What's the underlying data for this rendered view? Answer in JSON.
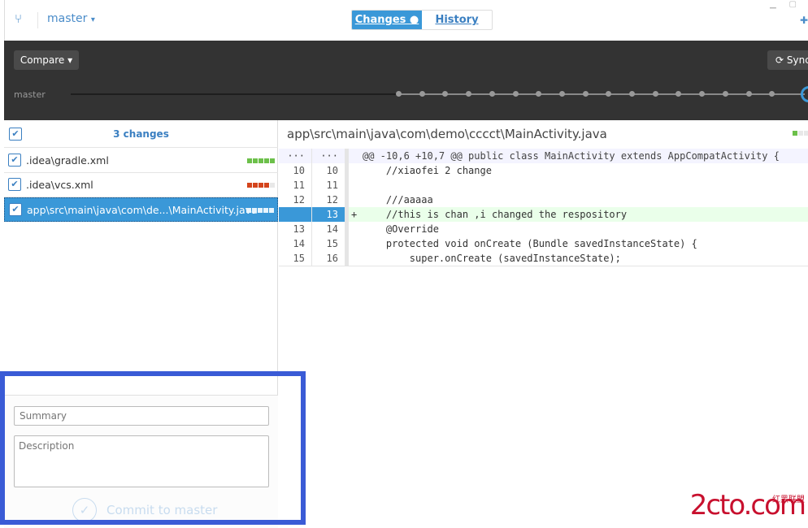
{
  "topbar": {
    "branch": "master",
    "branch_caret": "▾",
    "tabs": [
      {
        "label": "Changes ●",
        "active": true
      },
      {
        "label": "History",
        "active": false
      }
    ]
  },
  "toolbar": {
    "compare_label": "Compare ▾",
    "sync_label": "⟳ Sync",
    "timeline_branch": "master"
  },
  "changes": {
    "header": "3 changes",
    "files": [
      {
        "name": ".idea\\gradle.xml",
        "bars": [
          "#6cc04a",
          "#6cc04a",
          "#6cc04a",
          "#6cc04a",
          "#6cc04a"
        ],
        "selected": false
      },
      {
        "name": ".idea\\vcs.xml",
        "bars": [
          "#d4441c",
          "#d4441c",
          "#d4441c",
          "#d4441c",
          "#e8e8e8"
        ],
        "selected": false
      },
      {
        "name": "app\\src\\main\\java\\com\\de...\\MainActivity.java",
        "bars": [
          "#e8f4fc",
          "#e8f4fc",
          "#e8f4fc",
          "#e8f4fc",
          "#e8f4fc"
        ],
        "selected": true
      }
    ]
  },
  "commit": {
    "summary_placeholder": "Summary",
    "description_placeholder": "Description",
    "button_label": "Commit to master"
  },
  "diff": {
    "path": "app\\src\\main\\java\\com\\demo\\cccct\\MainActivity.java",
    "lines": [
      {
        "old": "···",
        "new": "···",
        "sign": "",
        "code": "@@ -10,6 +10,7 @@ public class MainActivity extends AppCompatActivity {",
        "type": "hunk"
      },
      {
        "old": "10",
        "new": "10",
        "sign": "",
        "code": "    //xiaofei 2 change",
        "type": "ctx"
      },
      {
        "old": "11",
        "new": "11",
        "sign": "",
        "code": "",
        "type": "ctx"
      },
      {
        "old": "12",
        "new": "12",
        "sign": "",
        "code": "    ///aaaaa",
        "type": "ctx"
      },
      {
        "old": "",
        "new": "13",
        "sign": "+",
        "code": "    //this is chan ,i changed the respository",
        "type": "add"
      },
      {
        "old": "13",
        "new": "14",
        "sign": "",
        "code": "    @Override",
        "type": "ctx"
      },
      {
        "old": "14",
        "new": "15",
        "sign": "",
        "code": "    protected void onCreate (Bundle savedInstanceState) {",
        "type": "ctx"
      },
      {
        "old": "15",
        "new": "16",
        "sign": "",
        "code": "        super.onCreate (savedInstanceState);",
        "type": "ctx"
      }
    ]
  },
  "watermark": {
    "text": "2cto.com",
    "sub": "红黑联盟"
  }
}
